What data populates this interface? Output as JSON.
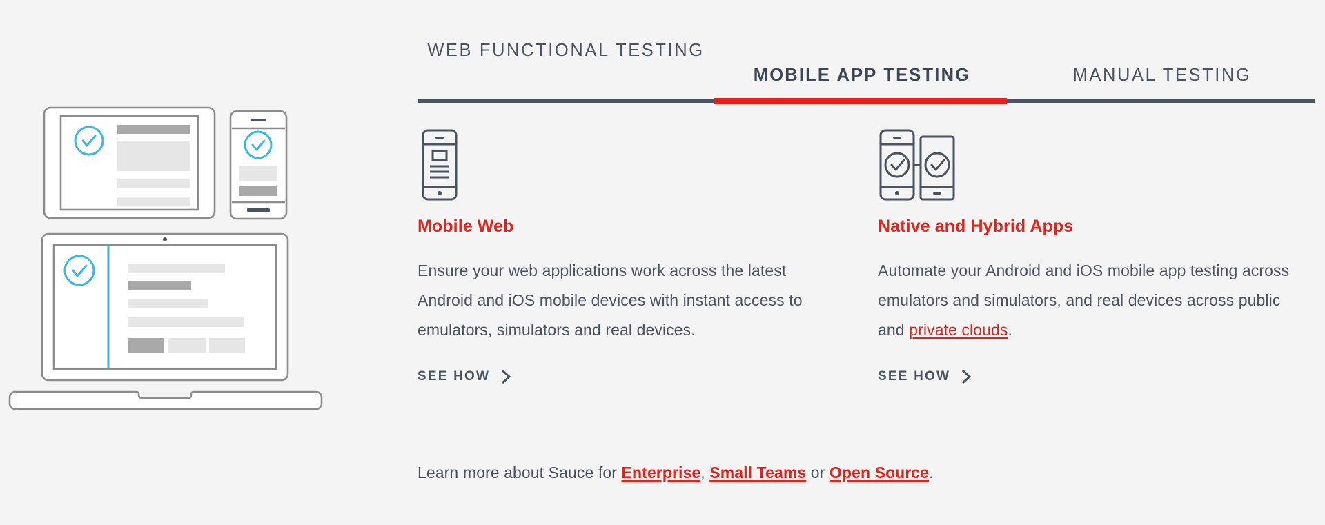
{
  "theme": {
    "background": "#f4f4f4",
    "accent_red": "#e32219",
    "text_dark": "#4a5360",
    "illustration_line": "#8c8c8c",
    "illustration_check": "#39b6ea",
    "illustration_block_light": "#e6e6e6",
    "illustration_block_dark": "#a8a8a8"
  },
  "tabs": [
    {
      "label": "Web Functional Testing",
      "active": false,
      "id": "web-functional-testing"
    },
    {
      "label": "Mobile App Testing",
      "active": true,
      "id": "mobile-app-testing"
    },
    {
      "label": "Manual Testing",
      "active": false,
      "id": "manual-testing"
    }
  ],
  "columns": [
    {
      "icon": "mobile-phone-icon",
      "title": "Mobile Web",
      "body_parts": [
        {
          "text": "Ensure your web applications work across the latest Android and iOS mobile devices with instant access to emulators, simulators and real devices.",
          "link": false
        }
      ],
      "cta_label": "See How",
      "cta_icon": "chevron-right-icon"
    },
    {
      "icon": "two-phones-check-icon",
      "title": "Native and Hybrid Apps",
      "body_parts": [
        {
          "text": "Automate your Android and iOS mobile app testing across emulators and simulators, and real devices across public and ",
          "link": false
        },
        {
          "text": "private clouds",
          "link": true
        },
        {
          "text": ".",
          "link": false
        }
      ],
      "cta_label": "See How",
      "cta_icon": "chevron-right-icon"
    }
  ],
  "learn_more": {
    "lead": "Learn more about Sauce for ",
    "link1": "Enterprise",
    "sep1": ", ",
    "link2": "Small Teams",
    "sep2": " or ",
    "link3": "Open Source",
    "tail": "."
  },
  "illustration": {
    "name": "devices-testing-illustration",
    "devices": [
      "tablet",
      "phone",
      "laptop"
    ]
  }
}
